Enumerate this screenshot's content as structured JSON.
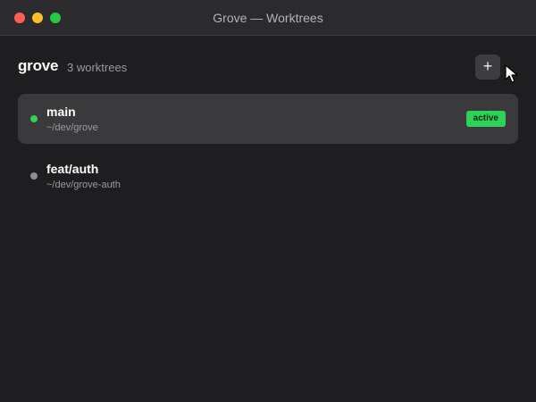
{
  "window": {
    "title": "Grove — Worktrees"
  },
  "header": {
    "repo_name": "grove",
    "worktree_count": "3 worktrees",
    "add_button_label": "+"
  },
  "worktrees": [
    {
      "branch": "main",
      "path": "~/dev/grove",
      "status": "active",
      "selected": true,
      "dot_color": "#30d158"
    },
    {
      "branch": "feat/auth",
      "path": "~/dev/grove-auth",
      "status": "",
      "selected": false,
      "dot_color": "#8e8e93"
    }
  ],
  "colors": {
    "accent_green": "#30d158",
    "background": "#1e1e20",
    "selected_row": "#3a3a3c"
  }
}
